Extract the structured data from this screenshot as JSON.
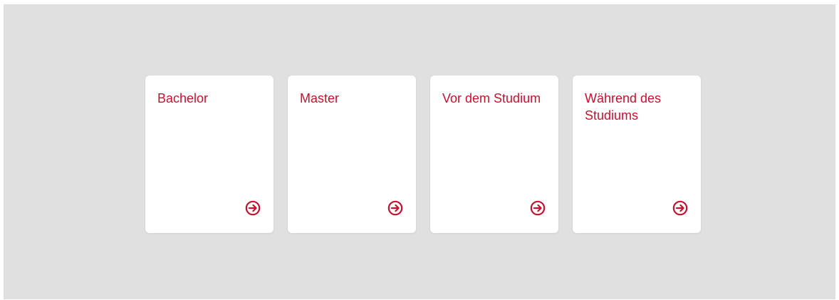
{
  "colors": {
    "background": "#e0e0e0",
    "card": "#ffffff",
    "accent": "#c8102e"
  },
  "cards": [
    {
      "title": "Bachelor",
      "icon": "arrow-right-circle-icon"
    },
    {
      "title": "Master",
      "icon": "arrow-right-circle-icon"
    },
    {
      "title": "Vor dem Studium",
      "icon": "arrow-right-circle-icon"
    },
    {
      "title": "Während des Studiums",
      "icon": "arrow-right-circle-icon"
    }
  ]
}
